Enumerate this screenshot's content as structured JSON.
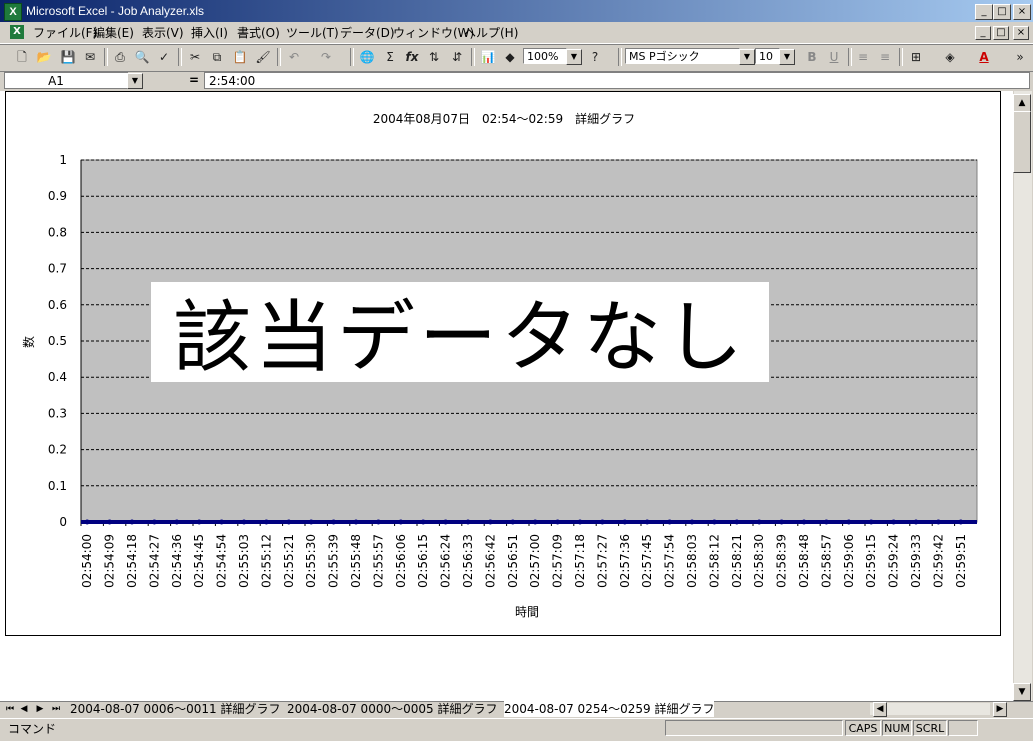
{
  "window": {
    "title": "Microsoft Excel - Job Analyzer.xls",
    "app_icon": "X",
    "buttons": {
      "minimize": "_",
      "maximize": "□",
      "close": "×"
    }
  },
  "menu": {
    "icon": "X",
    "items": [
      "ファイル(F)",
      "編集(E)",
      "表示(V)",
      "挿入(I)",
      "書式(O)",
      "ツール(T)",
      "データ(D)",
      "ウィンドウ(W)",
      "ヘルプ(H)"
    ]
  },
  "toolbar": {
    "zoom": "100%",
    "font_name": "MS Pゴシック",
    "font_size": "10",
    "bold": "B",
    "underline": "U"
  },
  "formula_bar": {
    "cell_ref": "A1",
    "equals": "=",
    "value": "2:54:00"
  },
  "chart_data": {
    "type": "line",
    "title": "2004年08月07日　02:54～02:59　詳細グラフ",
    "xlabel": "時間",
    "ylabel": "数",
    "ylim": [
      0,
      1
    ],
    "yticks": [
      "1",
      "0.9",
      "0.8",
      "0.7",
      "0.6",
      "0.5",
      "0.4",
      "0.3",
      "0.2",
      "0.1",
      "0"
    ],
    "grid": true,
    "categories": [
      "02:54:00",
      "02:54:09",
      "02:54:18",
      "02:54:27",
      "02:54:36",
      "02:54:45",
      "02:54:54",
      "02:55:03",
      "02:55:12",
      "02:55:21",
      "02:55:30",
      "02:55:39",
      "02:55:48",
      "02:55:57",
      "02:56:06",
      "02:56:15",
      "02:56:24",
      "02:56:33",
      "02:56:42",
      "02:56:51",
      "02:57:00",
      "02:57:09",
      "02:57:18",
      "02:57:27",
      "02:57:36",
      "02:57:45",
      "02:57:54",
      "02:58:03",
      "02:58:12",
      "02:58:21",
      "02:58:30",
      "02:58:39",
      "02:58:48",
      "02:58:57",
      "02:59:06",
      "02:59:15",
      "02:59:24",
      "02:59:33",
      "02:59:42",
      "02:59:51"
    ],
    "values": [
      0,
      0,
      0,
      0,
      0,
      0,
      0,
      0,
      0,
      0,
      0,
      0,
      0,
      0,
      0,
      0,
      0,
      0,
      0,
      0,
      0,
      0,
      0,
      0,
      0,
      0,
      0,
      0,
      0,
      0,
      0,
      0,
      0,
      0,
      0,
      0,
      0,
      0,
      0,
      0
    ],
    "overlay_text": "該当データなし",
    "plot_color": "#c0c0c0",
    "line_color": "#000080"
  },
  "sheet_tabs": [
    "2004-08-07 0006～0011 詳細グラフ",
    "2004-08-07 0000～0005 詳細グラフ",
    "2004-08-07 0254～0259 詳細グラフ"
  ],
  "status": {
    "mode": "コマンド",
    "caps": "CAPS",
    "num": "NUM",
    "scrl": "SCRL"
  }
}
